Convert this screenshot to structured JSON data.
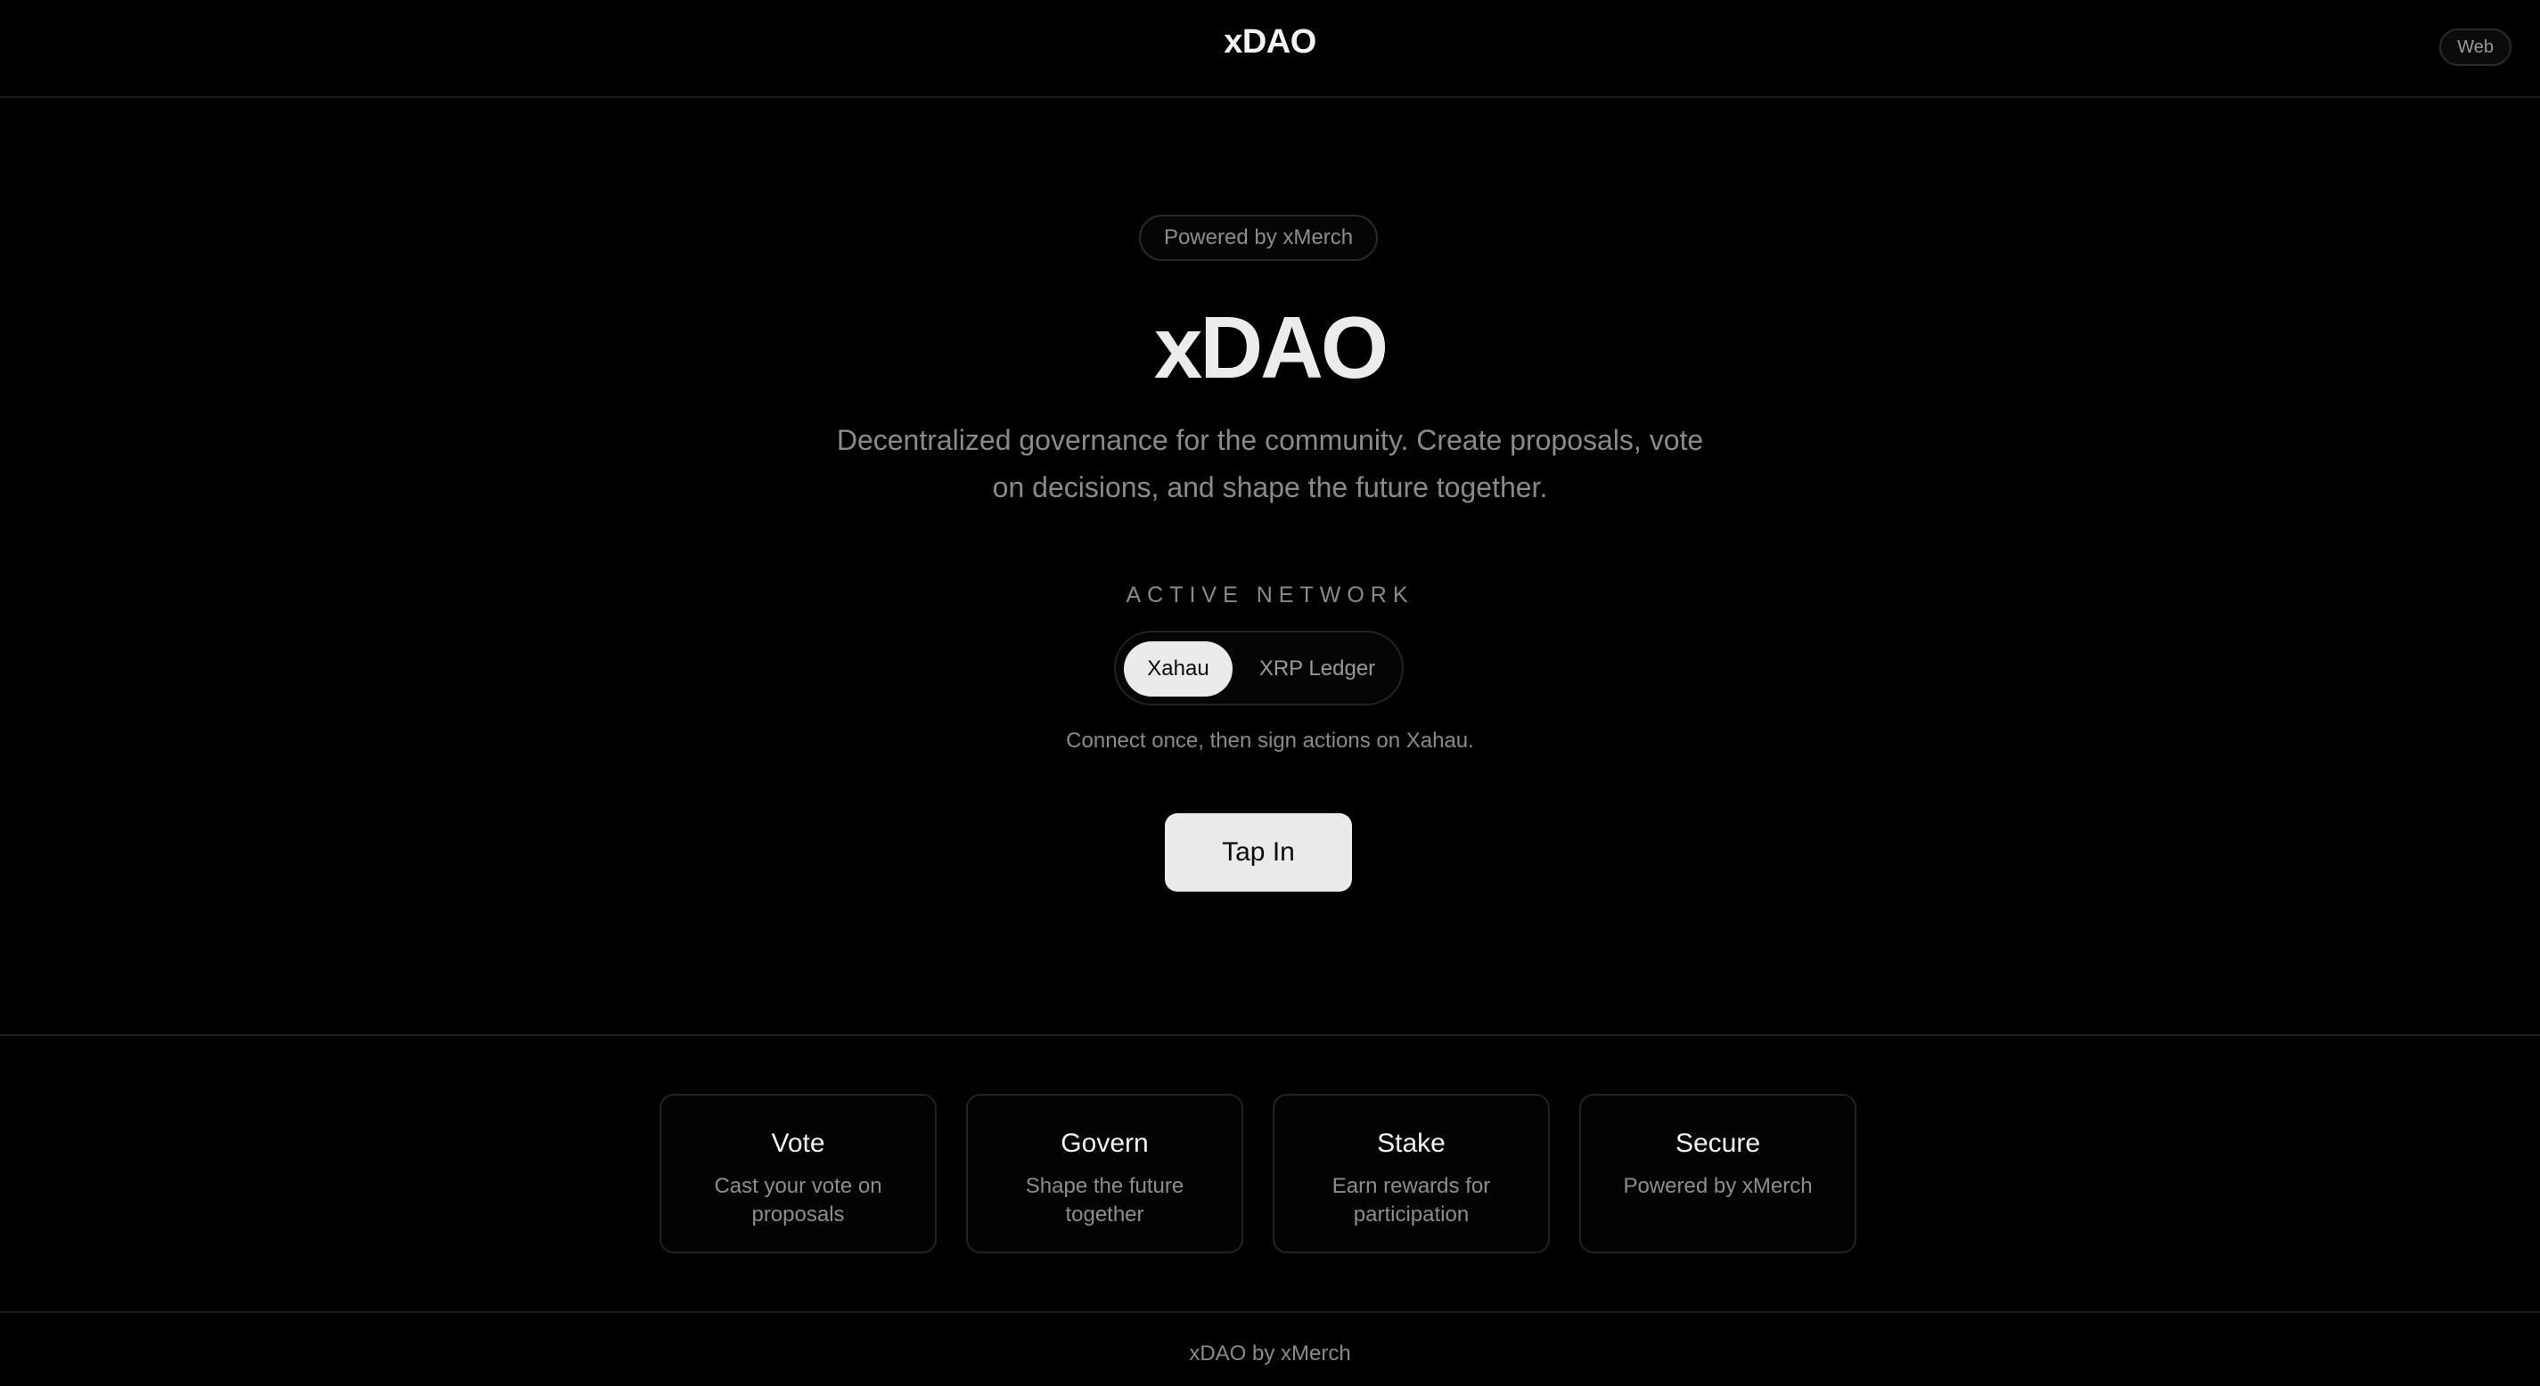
{
  "header": {
    "brand": "xDAO",
    "platform_badge": "Web"
  },
  "hero": {
    "powered_badge": "Powered by xMerch",
    "title": "xDAO",
    "description": "Decentralized governance for the community. Create proposals, vote on decisions, and shape the future together."
  },
  "network": {
    "label": "ACTIVE NETWORK",
    "options": [
      "Xahau",
      "XRP Ledger"
    ],
    "selected": "Xahau",
    "hint": "Connect once, then sign actions on Xahau."
  },
  "cta": {
    "label": "Tap In"
  },
  "features": [
    {
      "title": "Vote",
      "desc": "Cast your vote on proposals"
    },
    {
      "title": "Govern",
      "desc": "Shape the future together"
    },
    {
      "title": "Stake",
      "desc": "Earn rewards for participation"
    },
    {
      "title": "Secure",
      "desc": "Powered by xMerch"
    }
  ],
  "footer": {
    "text": "xDAO by xMerch"
  },
  "colors": {
    "background": "#000000",
    "primary_button": "#eaeaea",
    "muted_text": "#8a8a8a"
  }
}
